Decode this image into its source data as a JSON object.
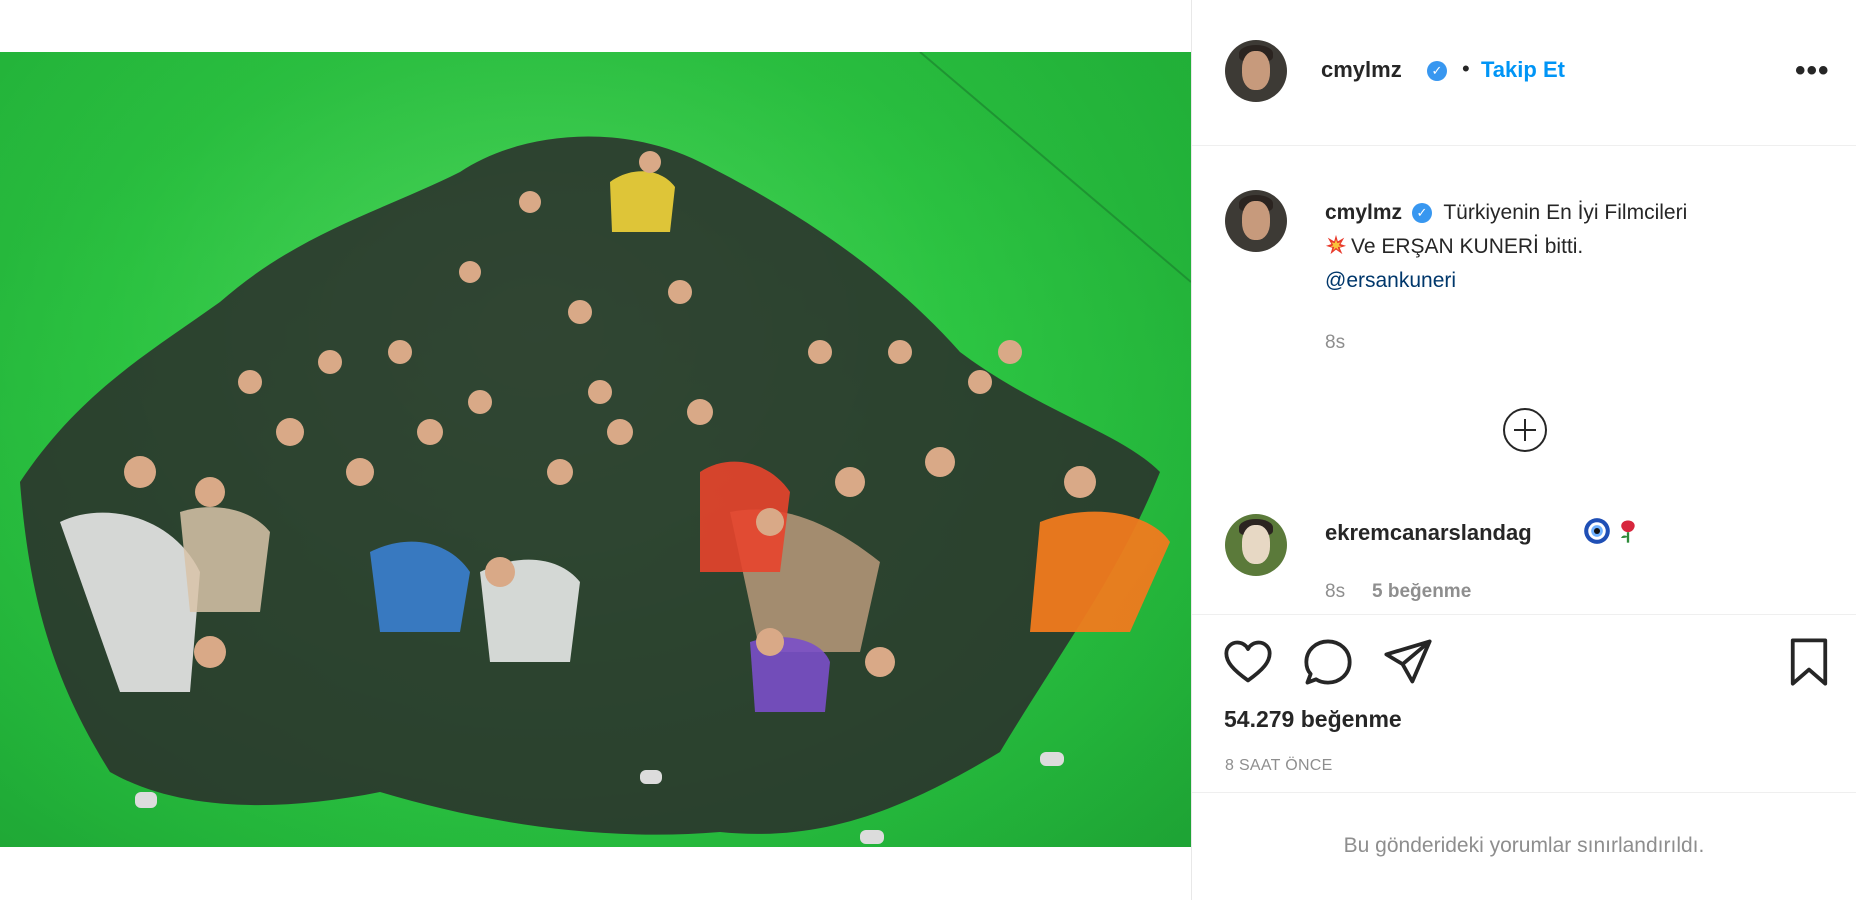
{
  "post": {
    "author": {
      "username": "cmylmz",
      "verified_icon": "verified-badge-icon",
      "separator": "•",
      "follow_label": "Takip Et",
      "more_icon": "more-options-icon",
      "more_label": "•••"
    },
    "caption": {
      "username": "cmylmz",
      "line1": "Türkiyenin En İyi Filmcileri",
      "line2_emoji": "collision-emoji",
      "line2": "Ve ERŞAN KUNERİ bitti.",
      "mention": "@ersankuneri",
      "time": "8s"
    },
    "load_more_icon": "plus-circle-icon",
    "comment": {
      "username": "ekremcanarslandag",
      "emojis": [
        "nazar-amulet-emoji",
        "rose-emoji"
      ],
      "time": "8s",
      "likes": "5 beğenme"
    },
    "actions": {
      "like_icon": "heart-icon",
      "comment_icon": "comment-icon",
      "share_icon": "share-icon",
      "save_icon": "bookmark-icon"
    },
    "likes_count": "54.279 beğenme",
    "timestamp": "8 SAAT ÖNCE",
    "comments_restricted": "Bu gönderideki yorumlar sınırlandırıldı."
  },
  "colors": {
    "link_blue": "#0095f6",
    "verified_blue": "#3897f0",
    "mention_blue": "#00376b",
    "muted_gray": "#8e8e8e",
    "green_screen": "#2fcf45"
  }
}
